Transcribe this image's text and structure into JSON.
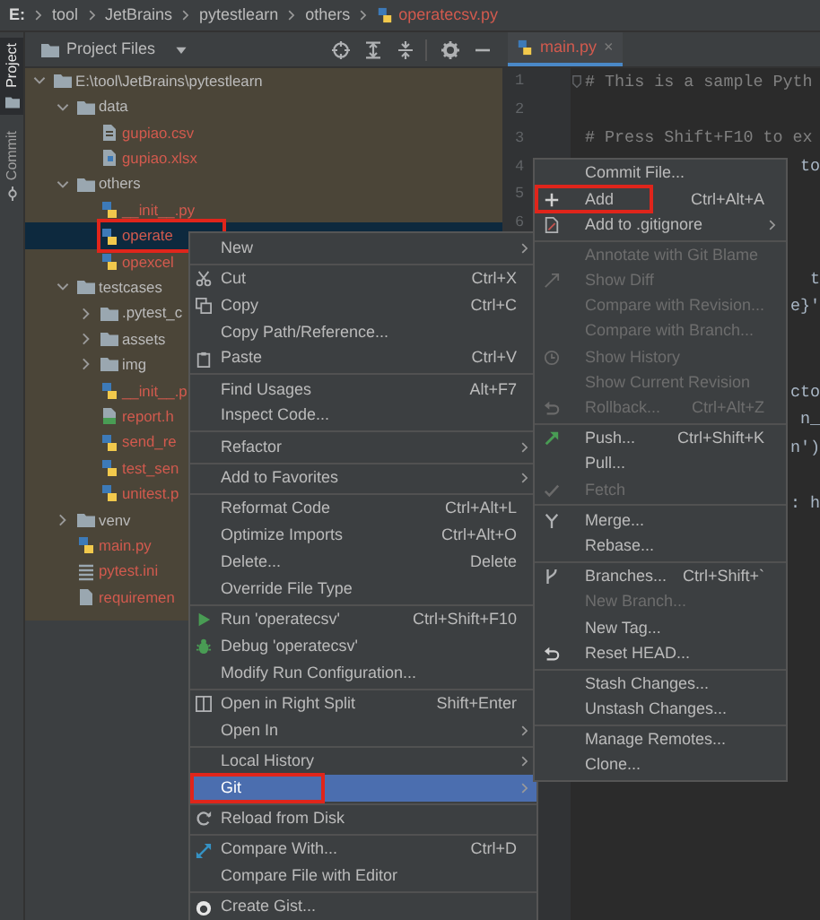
{
  "breadcrumb": [
    {
      "text": "E:",
      "kind": "drive"
    },
    {
      "text": "tool",
      "kind": "folder"
    },
    {
      "text": "JetBrains",
      "kind": "folder"
    },
    {
      "text": "pytestlearn",
      "kind": "folder"
    },
    {
      "text": "others",
      "kind": "folder"
    },
    {
      "text": "operatecsv.py",
      "kind": "file"
    }
  ],
  "tool_strip": [
    {
      "label": "Project",
      "selected": true
    },
    {
      "label": "Commit",
      "selected": false
    }
  ],
  "project_panel": {
    "title": "Project Files",
    "tree": [
      {
        "label": "E:\\tool\\JetBrains\\pytestlearn",
        "kind": "folder",
        "expanded": true,
        "selected": false,
        "boxed": false,
        "children": [
          {
            "label": "data",
            "kind": "folder",
            "expanded": true,
            "selected": false,
            "boxed": false,
            "children": [
              {
                "label": "gupiao.csv",
                "kind": "csv",
                "selected": false,
                "boxed": false
              },
              {
                "label": "gupiao.xlsx",
                "kind": "unknown",
                "selected": false,
                "boxed": false
              }
            ]
          },
          {
            "label": "others",
            "kind": "folder",
            "expanded": true,
            "selected": false,
            "boxed": false,
            "children": [
              {
                "label": "__init__.py",
                "kind": "python",
                "selected": false,
                "boxed": false
              },
              {
                "label": "operate",
                "kind": "python",
                "selected": true,
                "boxed": true
              },
              {
                "label": "opexcel",
                "kind": "python",
                "selected": false,
                "boxed": false
              }
            ]
          },
          {
            "label": "testcases",
            "kind": "folder",
            "expanded": true,
            "selected": false,
            "boxed": false,
            "children": [
              {
                "label": ".pytest_c",
                "kind": "folder",
                "expanded": false,
                "selected": false,
                "boxed": false
              },
              {
                "label": "assets",
                "kind": "folder",
                "expanded": false,
                "selected": false,
                "boxed": false
              },
              {
                "label": "img",
                "kind": "folder",
                "expanded": false,
                "selected": false,
                "boxed": false
              },
              {
                "label": "__init__.p",
                "kind": "python",
                "selected": false,
                "boxed": false
              },
              {
                "label": "report.h",
                "kind": "html",
                "selected": false,
                "boxed": false
              },
              {
                "label": "send_re",
                "kind": "python",
                "selected": false,
                "boxed": false
              },
              {
                "label": "test_sen",
                "kind": "python",
                "selected": false,
                "boxed": false
              },
              {
                "label": "unitest.p",
                "kind": "python",
                "selected": false,
                "boxed": false
              }
            ]
          },
          {
            "label": "venv",
            "kind": "folder",
            "expanded": false,
            "selected": false,
            "boxed": false
          },
          {
            "label": "main.py",
            "kind": "python",
            "selected": false,
            "boxed": false
          },
          {
            "label": "pytest.ini",
            "kind": "ini",
            "selected": false,
            "boxed": false
          },
          {
            "label": "requiremen",
            "kind": "text",
            "selected": false,
            "boxed": false
          }
        ]
      }
    ]
  },
  "editor": {
    "tabs": [
      {
        "label": "main.py",
        "close": "×",
        "selected": true
      }
    ],
    "line_numbers": [
      "1",
      "2",
      "3",
      "4",
      "5",
      "6"
    ],
    "lines": [
      {
        "kind": "comment",
        "text": "# This is a sample Pyth"
      },
      {
        "kind": "blank"
      },
      {
        "kind": "comment",
        "text": "# Press Shift+F10 to ex"
      },
      {
        "kind": "tail",
        "text": "to"
      },
      {
        "kind": "blank"
      },
      {
        "kind": "blank"
      },
      {
        "kind": "blank"
      },
      {
        "kind": "tail",
        "text": "t"
      },
      {
        "kind": "tail",
        "text": "e}'"
      },
      {
        "kind": "blank"
      },
      {
        "kind": "blank"
      },
      {
        "kind": "tail",
        "text": "cto"
      },
      {
        "kind": "tail",
        "text": "n_"
      },
      {
        "kind": "tail",
        "text": "n')"
      },
      {
        "kind": "blank"
      },
      {
        "kind": "tail",
        "text": ": h"
      }
    ]
  },
  "context_menu": {
    "items": [
      {
        "kind": "submenu",
        "label": "New",
        "selected": false,
        "boxed": false
      },
      {
        "kind": "separator"
      },
      {
        "kind": "command",
        "label": "Cut",
        "shortcut": "Ctrl+X",
        "selected": false,
        "boxed": false
      },
      {
        "kind": "command",
        "label": "Copy",
        "shortcut": "Ctrl+C",
        "selected": false,
        "boxed": false
      },
      {
        "kind": "command",
        "label": "Copy Path/Reference...",
        "selected": false,
        "boxed": false
      },
      {
        "kind": "command",
        "label": "Paste",
        "shortcut": "Ctrl+V",
        "selected": false,
        "boxed": false
      },
      {
        "kind": "separator"
      },
      {
        "kind": "command",
        "label": "Find Usages",
        "shortcut": "Alt+F7",
        "selected": false,
        "boxed": false
      },
      {
        "kind": "command",
        "label": "Inspect Code...",
        "selected": false,
        "boxed": false
      },
      {
        "kind": "separator"
      },
      {
        "kind": "submenu",
        "label": "Refactor",
        "selected": false,
        "boxed": false
      },
      {
        "kind": "separator"
      },
      {
        "kind": "submenu",
        "label": "Add to Favorites",
        "selected": false,
        "boxed": false
      },
      {
        "kind": "separator"
      },
      {
        "kind": "command",
        "label": "Reformat Code",
        "shortcut": "Ctrl+Alt+L",
        "selected": false,
        "boxed": false
      },
      {
        "kind": "command",
        "label": "Optimize Imports",
        "shortcut": "Ctrl+Alt+O",
        "selected": false,
        "boxed": false
      },
      {
        "kind": "command",
        "label": "Delete...",
        "shortcut": "Delete",
        "selected": false,
        "boxed": false
      },
      {
        "kind": "command",
        "label": "Override File Type",
        "selected": false,
        "boxed": false
      },
      {
        "kind": "separator"
      },
      {
        "kind": "command",
        "label": "Run 'operatecsv'",
        "shortcut": "Ctrl+Shift+F10",
        "selected": false,
        "boxed": false
      },
      {
        "kind": "command",
        "label": "Debug 'operatecsv'",
        "selected": false,
        "boxed": false
      },
      {
        "kind": "command",
        "label": "Modify Run Configuration...",
        "selected": false,
        "boxed": false
      },
      {
        "kind": "separator"
      },
      {
        "kind": "command",
        "label": "Open in Right Split",
        "shortcut": "Shift+Enter",
        "selected": false,
        "boxed": false
      },
      {
        "kind": "submenu",
        "label": "Open In",
        "selected": false,
        "boxed": false
      },
      {
        "kind": "separator"
      },
      {
        "kind": "submenu",
        "label": "Local History",
        "selected": false,
        "boxed": false
      },
      {
        "kind": "submenu",
        "label": "Git",
        "selected": true,
        "boxed": true
      },
      {
        "kind": "separator"
      },
      {
        "kind": "command",
        "label": "Reload from Disk",
        "selected": false,
        "boxed": false
      },
      {
        "kind": "separator"
      },
      {
        "kind": "command",
        "label": "Compare With...",
        "shortcut": "Ctrl+D",
        "selected": false,
        "boxed": false
      },
      {
        "kind": "command",
        "label": "Compare File with Editor",
        "selected": false,
        "boxed": false
      },
      {
        "kind": "separator"
      },
      {
        "kind": "command",
        "label": "Create Gist...",
        "selected": false,
        "boxed": false
      }
    ]
  },
  "git_submenu": {
    "items": [
      {
        "kind": "command",
        "label": "Commit File...",
        "disabled": false,
        "boxed": false
      },
      {
        "kind": "command",
        "label": "Add",
        "shortcut": "Ctrl+Alt+A",
        "disabled": false,
        "boxed": true
      },
      {
        "kind": "submenu",
        "label": "Add to .gitignore",
        "disabled": false,
        "boxed": false
      },
      {
        "kind": "separator"
      },
      {
        "kind": "command",
        "label": "Annotate with Git Blame",
        "disabled": true,
        "boxed": false
      },
      {
        "kind": "command",
        "label": "Show Diff",
        "disabled": true,
        "boxed": false
      },
      {
        "kind": "command",
        "label": "Compare with Revision...",
        "disabled": true,
        "boxed": false
      },
      {
        "kind": "command",
        "label": "Compare with Branch...",
        "disabled": true,
        "boxed": false
      },
      {
        "kind": "command",
        "label": "Show History",
        "disabled": true,
        "boxed": false
      },
      {
        "kind": "command",
        "label": "Show Current Revision",
        "disabled": true,
        "boxed": false
      },
      {
        "kind": "command",
        "label": "Rollback...",
        "shortcut": "Ctrl+Alt+Z",
        "disabled": true,
        "boxed": false
      },
      {
        "kind": "separator"
      },
      {
        "kind": "command",
        "label": "Push...",
        "shortcut": "Ctrl+Shift+K",
        "disabled": false,
        "boxed": false
      },
      {
        "kind": "command",
        "label": "Pull...",
        "disabled": false,
        "boxed": false
      },
      {
        "kind": "command",
        "label": "Fetch",
        "disabled": true,
        "boxed": false
      },
      {
        "kind": "separator"
      },
      {
        "kind": "command",
        "label": "Merge...",
        "disabled": false,
        "boxed": false
      },
      {
        "kind": "command",
        "label": "Rebase...",
        "disabled": false,
        "boxed": false
      },
      {
        "kind": "separator"
      },
      {
        "kind": "command",
        "label": "Branches...",
        "shortcut": "Ctrl+Shift+`",
        "disabled": false,
        "boxed": false
      },
      {
        "kind": "command",
        "label": "New Branch...",
        "disabled": true,
        "boxed": false
      },
      {
        "kind": "command",
        "label": "New Tag...",
        "disabled": false,
        "boxed": false
      },
      {
        "kind": "command",
        "label": "Reset HEAD...",
        "disabled": false,
        "boxed": false
      },
      {
        "kind": "separator"
      },
      {
        "kind": "command",
        "label": "Stash Changes...",
        "disabled": false,
        "boxed": false
      },
      {
        "kind": "command",
        "label": "Unstash Changes...",
        "disabled": false,
        "boxed": false
      },
      {
        "kind": "separator"
      },
      {
        "kind": "command",
        "label": "Manage Remotes...",
        "disabled": false,
        "boxed": false
      },
      {
        "kind": "command",
        "label": "Clone...",
        "disabled": false,
        "boxed": false
      }
    ]
  }
}
